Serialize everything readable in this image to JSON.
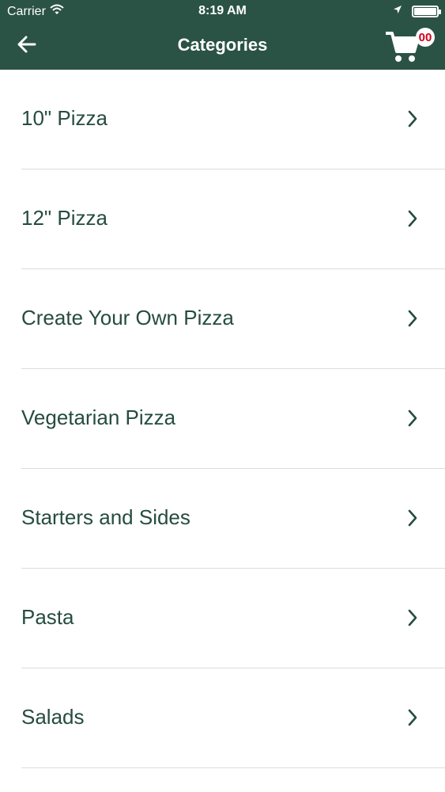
{
  "status_bar": {
    "carrier": "Carrier",
    "time": "8:19 AM"
  },
  "nav": {
    "title": "Categories",
    "back_icon": "arrow-left-icon",
    "cart_icon": "shopping-cart-icon",
    "cart_count": "00"
  },
  "categories": [
    {
      "label": "10\" Pizza"
    },
    {
      "label": "12\" Pizza"
    },
    {
      "label": "Create Your Own Pizza"
    },
    {
      "label": "Vegetarian Pizza"
    },
    {
      "label": "Starters and Sides"
    },
    {
      "label": "Pasta"
    },
    {
      "label": "Salads"
    }
  ],
  "colors": {
    "header": "#2a5345",
    "text": "#254c3f",
    "badge_text": "#d0021b"
  }
}
